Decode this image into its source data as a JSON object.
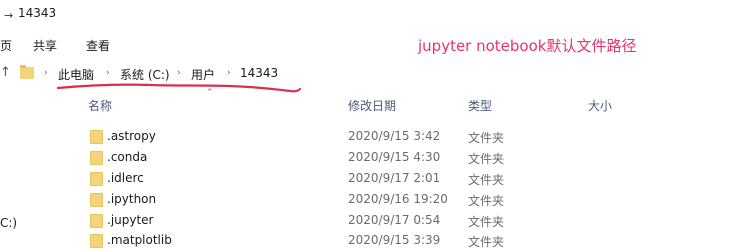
{
  "window": {
    "title_prefix": "→",
    "title": "14343"
  },
  "ribbon": {
    "tabs": [
      {
        "label": "页"
      },
      {
        "label": "共享"
      },
      {
        "label": "查看"
      }
    ]
  },
  "annotation": {
    "text": "jupyter  notebook默认文件路径",
    "color": "#e8336f"
  },
  "address_bar": {
    "up_icon": "arrow-up-icon",
    "folder_icon": "folder-icon",
    "separator": "›",
    "crumbs": [
      {
        "label": "此电脑"
      },
      {
        "label": "系统 (C:)"
      },
      {
        "label": "用户"
      },
      {
        "label": "14343"
      }
    ]
  },
  "columns": {
    "name": "名称",
    "modified": "修改日期",
    "type": "类型",
    "size": "大小"
  },
  "sidebar": {
    "partial_label": "C:)"
  },
  "files": [
    {
      "name": ".astropy",
      "modified": "2020/9/15 3:42",
      "type": "文件夹"
    },
    {
      "name": ".conda",
      "modified": "2020/9/15 4:30",
      "type": "文件夹"
    },
    {
      "name": ".idlerc",
      "modified": "2020/9/17 2:01",
      "type": "文件夹"
    },
    {
      "name": ".ipython",
      "modified": "2020/9/16 19:20",
      "type": "文件夹"
    },
    {
      "name": ".jupyter",
      "modified": "2020/9/17 0:54",
      "type": "文件夹"
    },
    {
      "name": ".matplotlib",
      "modified": "2020/9/15 3:39",
      "type": "文件夹"
    }
  ]
}
